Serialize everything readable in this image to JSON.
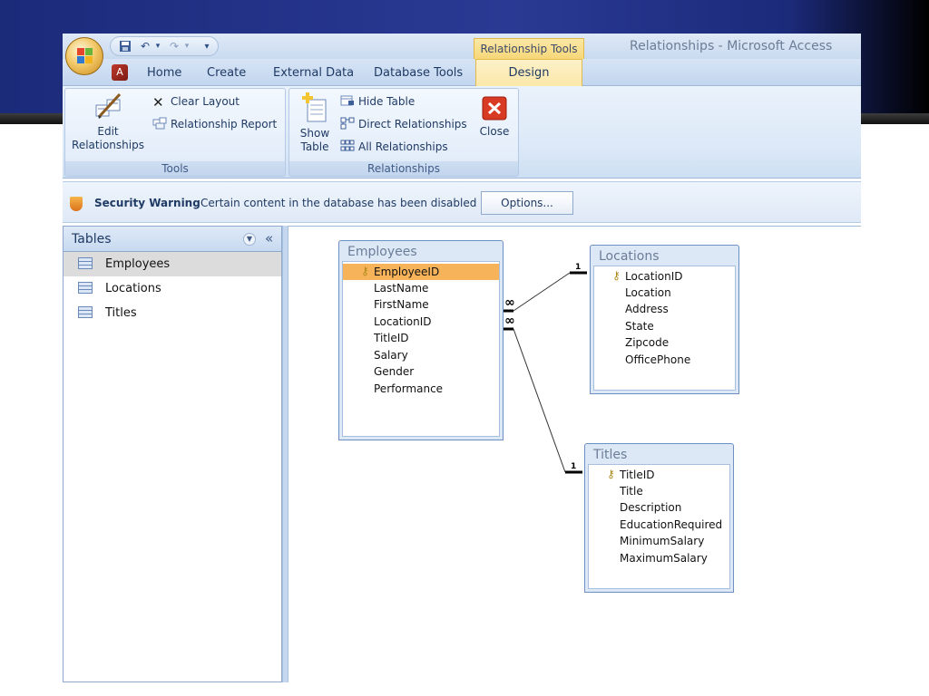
{
  "window": {
    "context_tab_title": "Relationship Tools",
    "title": "Relationships - Microsoft Access"
  },
  "ribbon_tabs": {
    "home": "Home",
    "create": "Create",
    "external_data": "External Data",
    "database_tools": "Database Tools",
    "design": "Design"
  },
  "tools_group": {
    "label": "Tools",
    "edit_relationships_line1": "Edit",
    "edit_relationships_line2": "Relationships",
    "clear_layout": "Clear Layout",
    "relationship_report": "Relationship Report"
  },
  "relationships_group": {
    "label": "Relationships",
    "show_table_line1": "Show",
    "show_table_line2": "Table",
    "hide_table": "Hide Table",
    "direct_relationships": "Direct Relationships",
    "all_relationships": "All Relationships",
    "close": "Close"
  },
  "security": {
    "title": "Security Warning",
    "message": "Certain content in the database has been disabled",
    "options_button": "Options..."
  },
  "nav_pane": {
    "header": "Tables",
    "items": [
      "Employees",
      "Locations",
      "Titles"
    ],
    "selected": "Employees"
  },
  "tables": {
    "employees": {
      "title": "Employees",
      "key_field": "EmployeeID",
      "fields": [
        "LastName",
        "FirstName",
        "LocationID",
        "TitleID",
        "Salary",
        "Gender",
        "Performance"
      ]
    },
    "locations": {
      "title": "Locations",
      "key_field": "LocationID",
      "fields": [
        "Location",
        "Address",
        "State",
        "Zipcode",
        "OfficePhone"
      ]
    },
    "titles": {
      "title": "Titles",
      "key_field": "TitleID",
      "fields": [
        "Title",
        "Description",
        "EducationRequired",
        "MinimumSalary",
        "MaximumSalary"
      ]
    }
  },
  "relationships": {
    "one_label": "1",
    "many_label": "∞"
  },
  "colors": {
    "highlight": "#f7b35a",
    "slide_band": "#1c2a7a",
    "context_tab": "#f6d778"
  }
}
